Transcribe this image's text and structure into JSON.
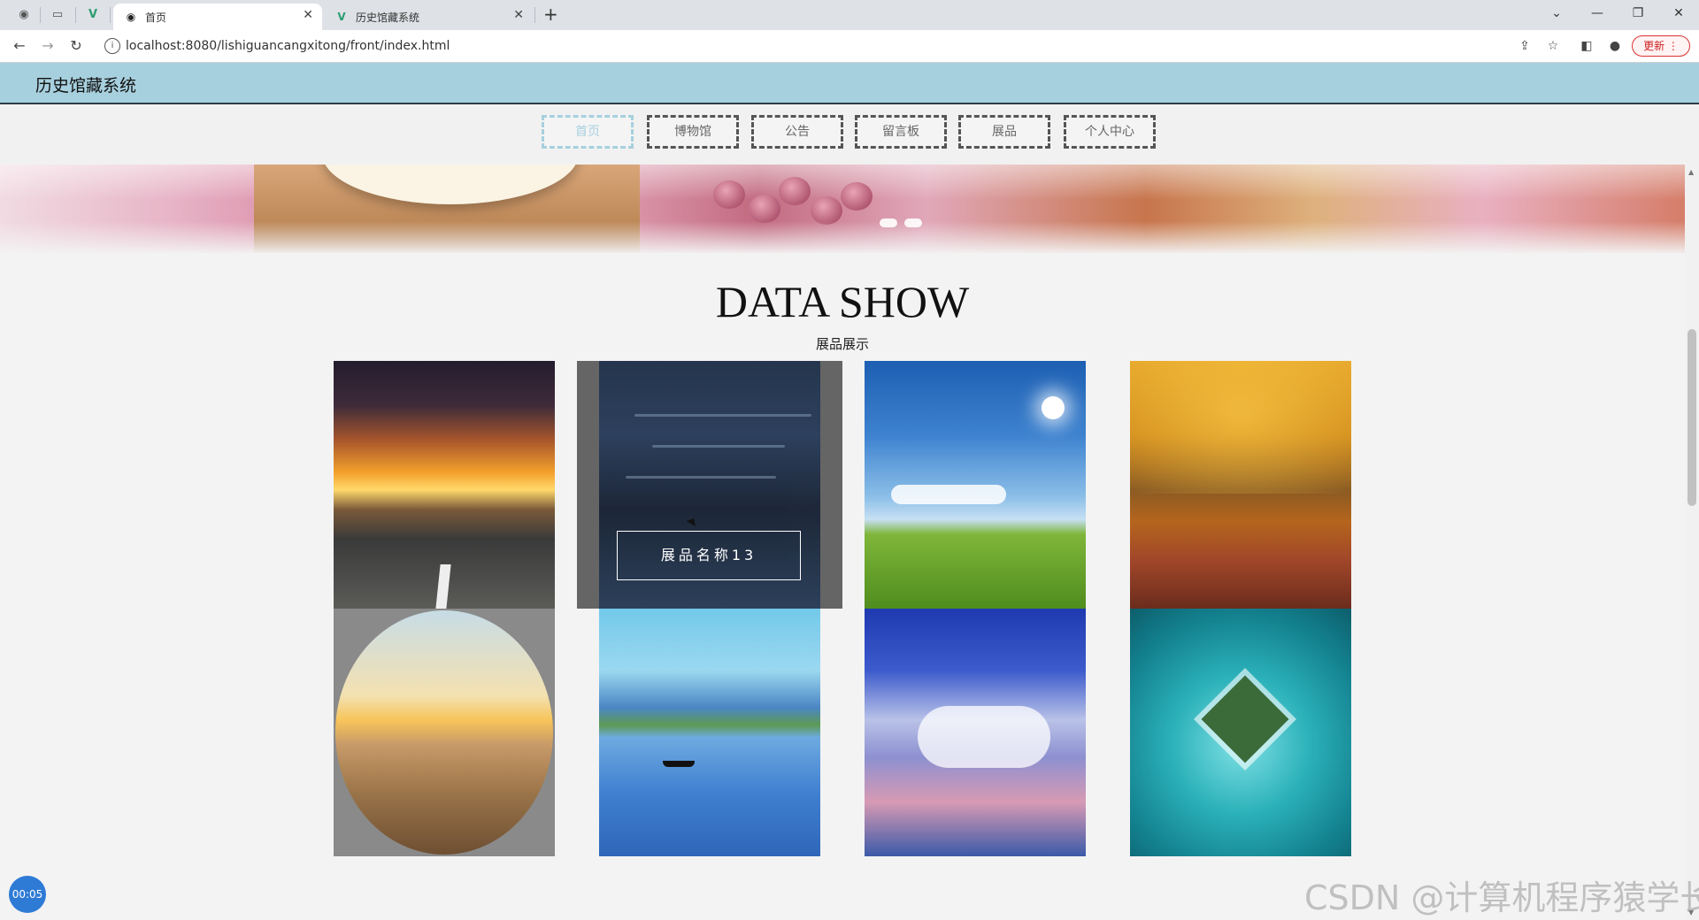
{
  "browser": {
    "tabs": [
      {
        "title": "首页",
        "active": true
      },
      {
        "title": "历史馆藏系统",
        "active": false
      }
    ],
    "url": "localhost:8080/lishiguancangxitong/front/index.html",
    "update_label": "更新"
  },
  "site": {
    "title": "历史馆藏系统",
    "nav": [
      {
        "label": "首页",
        "active": true
      },
      {
        "label": "博物馆",
        "active": false
      },
      {
        "label": "公告",
        "active": false
      },
      {
        "label": "留言板",
        "active": false
      },
      {
        "label": "展品",
        "active": false
      },
      {
        "label": "个人中心",
        "active": false
      }
    ]
  },
  "data_show": {
    "title": "DATA SHOW",
    "subtitle": "展品展示",
    "hover_item_name": "展品名称13"
  },
  "overlay": {
    "timer": "00:05",
    "watermark": "CSDN @计算机程序猿学长"
  },
  "colors": {
    "header_bg": "#a7d0de",
    "active_nav": "#a7d0de"
  }
}
